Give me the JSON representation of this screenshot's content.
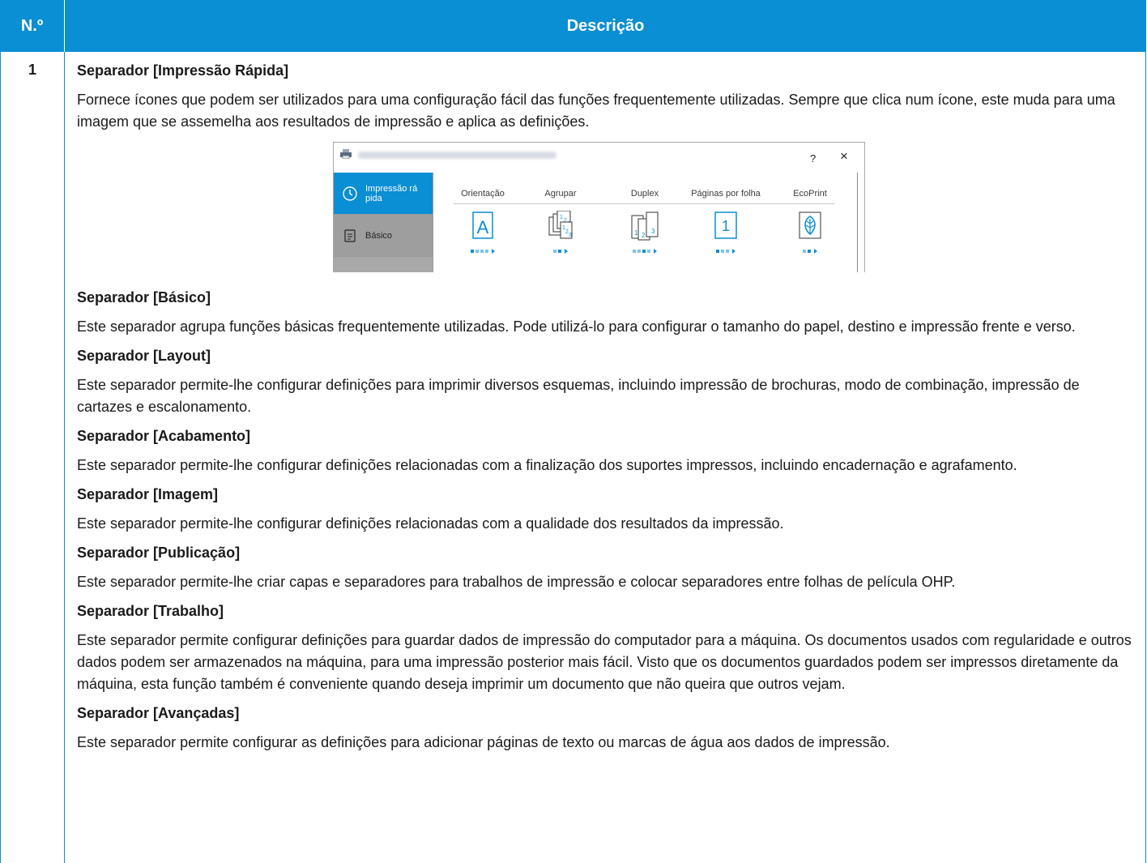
{
  "header": {
    "num": "N.º",
    "desc": "Descrição"
  },
  "row": {
    "num": "1",
    "sections": [
      {
        "title": "Separador [Impressão Rápida]",
        "desc": "Fornece ícones que podem ser utilizados para uma configuração fácil das funções frequentemente utilizadas. Sempre que clica num ícone, este muda para uma imagem que se assemelha aos resultados de impressão e aplica as definições."
      },
      {
        "title": "Separador [Básico]",
        "desc": "Este separador agrupa funções básicas frequentemente utilizadas. Pode utilizá-lo para configurar o tamanho do papel, destino e impressão frente e verso."
      },
      {
        "title": "Separador [Layout]",
        "desc": "Este separador permite-lhe configurar definições para imprimir diversos esquemas, incluindo impressão de brochuras, modo de combinação, impressão de cartazes e escalonamento."
      },
      {
        "title": "Separador [Acabamento]",
        "desc": "Este separador permite-lhe configurar definições relacionadas com a finalização dos suportes impressos, incluindo encadernação e agrafamento."
      },
      {
        "title": "Separador [Imagem]",
        "desc": "Este separador permite-lhe configurar definições relacionadas com a qualidade dos resultados da impressão."
      },
      {
        "title": "Separador [Publicação]",
        "desc": "Este separador permite-lhe criar capas e separadores para trabalhos de impressão e colocar separadores entre folhas de película OHP."
      },
      {
        "title": "Separador [Trabalho]",
        "desc": "Este separador permite configurar definições para guardar dados de impressão do computador para a máquina. Os documentos usados com regularidade e outros dados podem ser armazenados na máquina, para uma impressão posterior mais fácil. Visto que os documentos guardados podem ser impressos diretamente da máquina, esta função também é conveniente quando deseja imprimir um documento que não queira que outros vejam."
      },
      {
        "title": "Separador [Avançadas]",
        "desc": "Este separador permite configurar as definições para adicionar páginas de texto ou marcas de água aos dados de impressão."
      }
    ]
  },
  "screenshot": {
    "help": "?",
    "close": "×",
    "sidebar": [
      {
        "label": "Impressão rá\npida",
        "icon": "clock-icon"
      },
      {
        "label": "Básico",
        "icon": "document-icon"
      }
    ],
    "quickprint": [
      {
        "label": "Orientação",
        "icon": "orientation-icon"
      },
      {
        "label": "Agrupar",
        "icon": "collate-icon"
      },
      {
        "label": "Duplex",
        "icon": "duplex-icon"
      },
      {
        "label": "Páginas por folha",
        "icon": "pages-per-sheet-icon"
      },
      {
        "label": "EcoPrint",
        "icon": "ecoprint-leaf-icon"
      }
    ],
    "colors": {
      "accent": "#0a8ed4",
      "sidebar": "#9a9a9a"
    }
  }
}
